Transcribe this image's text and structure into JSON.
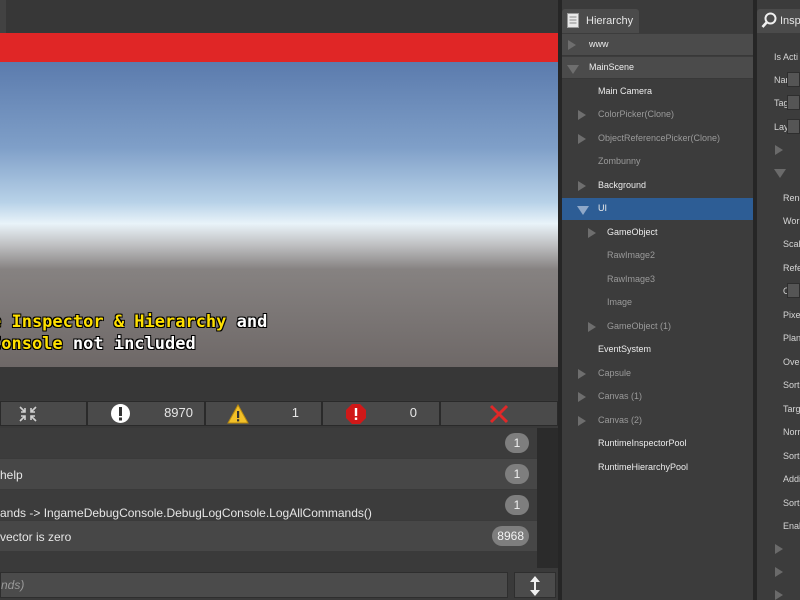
{
  "overlay": {
    "line1_highlight": "e Inspector & Hierarchy",
    "line1_rest": " and",
    "line2_highlight": "Console",
    "line2_rest": " not included"
  },
  "console": {
    "toolbar": {
      "info_count": "8970",
      "warning_count": "1",
      "error_count": "0"
    },
    "logs": [
      {
        "text": "",
        "count": "1"
      },
      {
        "text": "help",
        "count": "1"
      },
      {
        "text": "ands -> IngameDebugConsole.DebugLogConsole.LogAllCommands()",
        "count": "1"
      },
      {
        "text": "vector is zero",
        "count": "8968"
      }
    ],
    "command_placeholder": "nds)"
  },
  "hierarchy": {
    "title": "Hierarchy",
    "scenes": [
      {
        "name": "www"
      },
      {
        "name": "MainScene"
      }
    ],
    "items": [
      {
        "name": "Main Camera"
      },
      {
        "name": "ColorPicker(Clone)"
      },
      {
        "name": "ObjectReferencePicker(Clone)"
      },
      {
        "name": "Zombunny"
      },
      {
        "name": "Background"
      },
      {
        "name": "UI"
      },
      {
        "name": "GameObject"
      },
      {
        "name": "RawImage2"
      },
      {
        "name": "RawImage3"
      },
      {
        "name": "Image"
      },
      {
        "name": "GameObject (1)"
      },
      {
        "name": "EventSystem"
      },
      {
        "name": "Capsule"
      },
      {
        "name": "Canvas (1)"
      },
      {
        "name": "Canvas (2)"
      },
      {
        "name": "RuntimeInspectorPool"
      },
      {
        "name": "RuntimeHierarchyPool"
      }
    ],
    "colors": {
      "selected": "#2d5d95",
      "active_text": "#ececec",
      "inactive_text": "#9a9a9a"
    }
  },
  "inspector": {
    "title": "Insp",
    "labels": [
      "Is Acti",
      "Name",
      "Tag",
      "Layer",
      "Rend",
      "Work",
      "Scal",
      "Refe",
      "Ove",
      "Pixe",
      "Plan",
      "Ove",
      "Sorti",
      "Targ",
      "Norr",
      "Sorti",
      "Addi",
      "Sorti",
      "Enab"
    ]
  },
  "icons": {
    "collapse": "collapse-arrows-icon",
    "info": "info-circle-icon",
    "warning": "warning-triangle-icon",
    "error": "error-octagon-icon",
    "clear": "close-x-icon",
    "resize": "vertical-resize-icon",
    "search": "search-icon"
  }
}
